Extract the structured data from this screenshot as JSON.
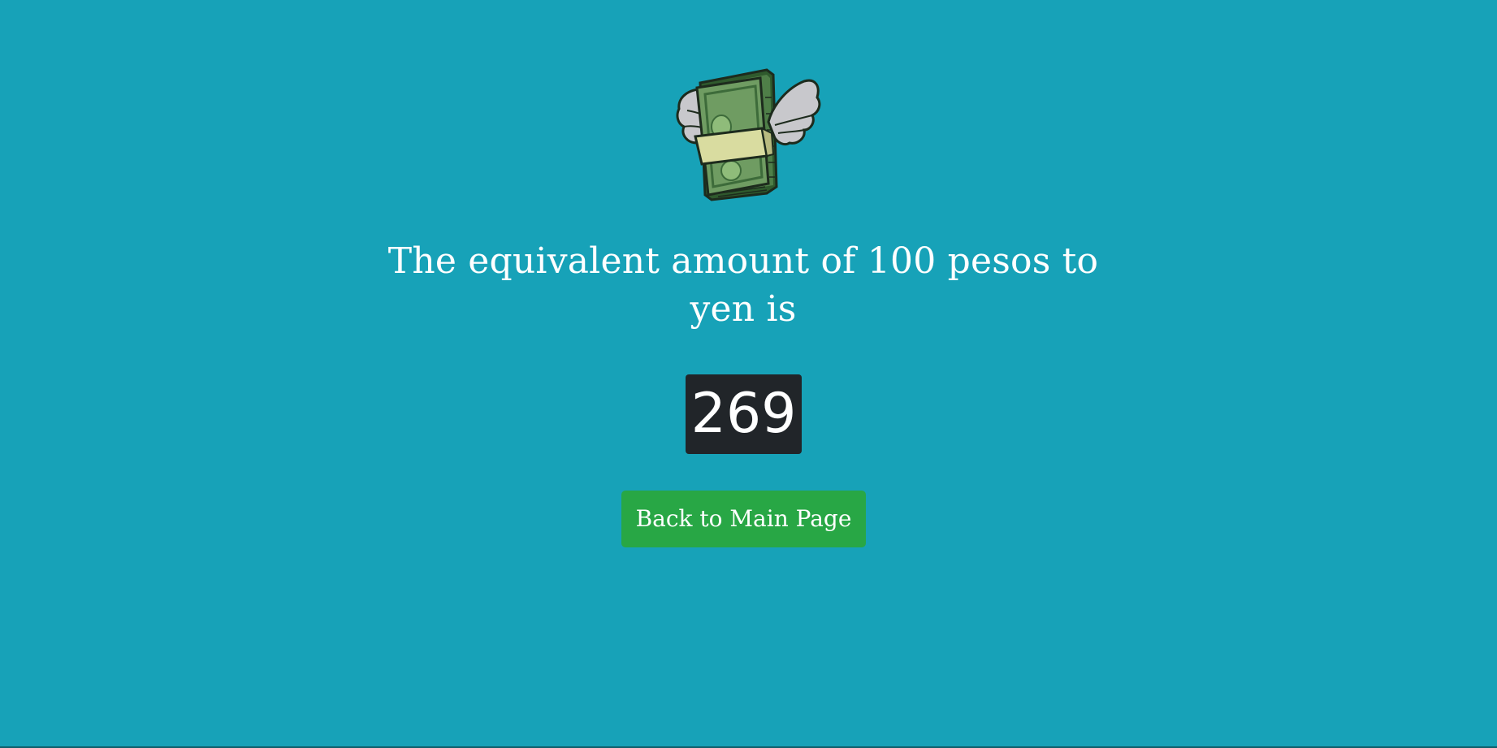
{
  "logo": {
    "icon": "flying-money-icon",
    "colors": {
      "bill_dark": "#3d6b3a",
      "bill_light": "#8fbc7a",
      "band": "#d9dca0",
      "wing": "#c8c8cc",
      "outline": "#1d2b1d"
    }
  },
  "heading": {
    "text": "The equivalent amount of 100 pesos to yen is"
  },
  "result": {
    "value": "269"
  },
  "actions": {
    "back_label": "Back to Main Page"
  },
  "colors": {
    "background": "#17a2b8",
    "badge": "#212529",
    "button": "#28a745",
    "text": "#ffffff"
  }
}
